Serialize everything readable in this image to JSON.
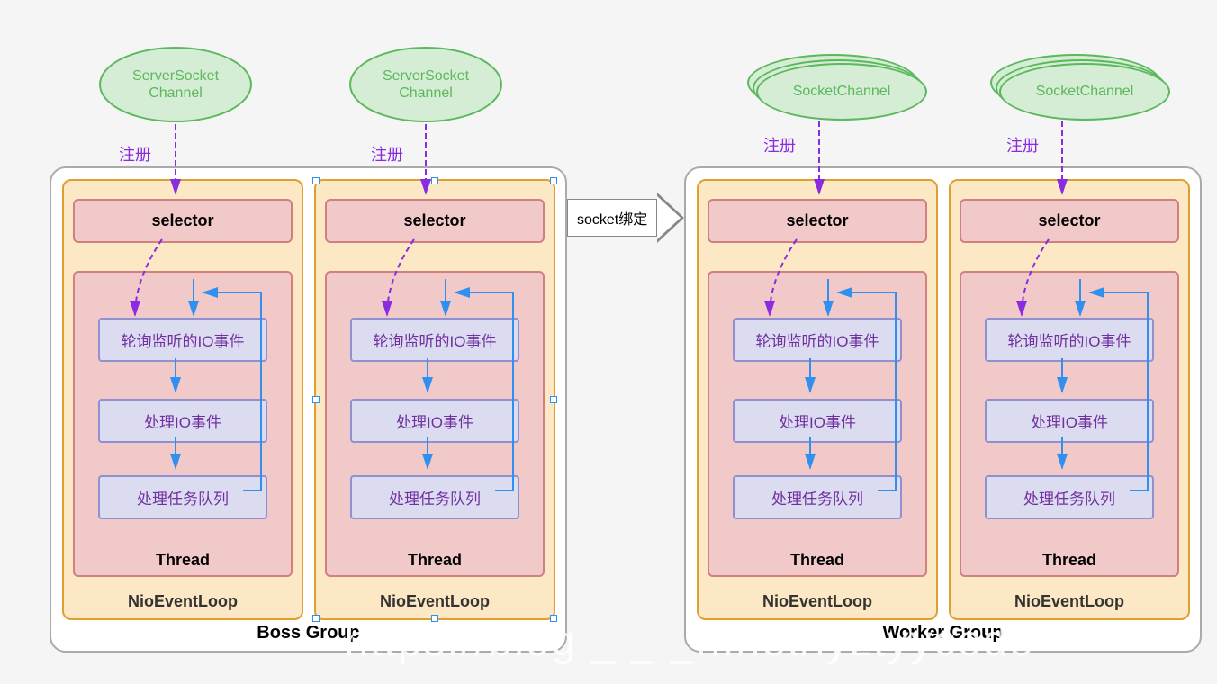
{
  "ellipses": {
    "server1": "ServerSocket\nChannel",
    "server2": "ServerSocket\nChannel",
    "socket1": "SocketChannel",
    "socket2": "SocketChannel"
  },
  "registerLabel": "注册",
  "socketBind": "socket绑定",
  "groups": {
    "boss": "Boss Group",
    "worker": "Worker Group"
  },
  "loop": {
    "label": "NioEventLoop",
    "selector": "selector",
    "thread": "Thread",
    "step1": "轮询监听的IO事件",
    "step2": "处理IO事件",
    "step3": "处理任务队列"
  },
  "watermark": "https://blog _ _ _h.net/lyztyycode"
}
